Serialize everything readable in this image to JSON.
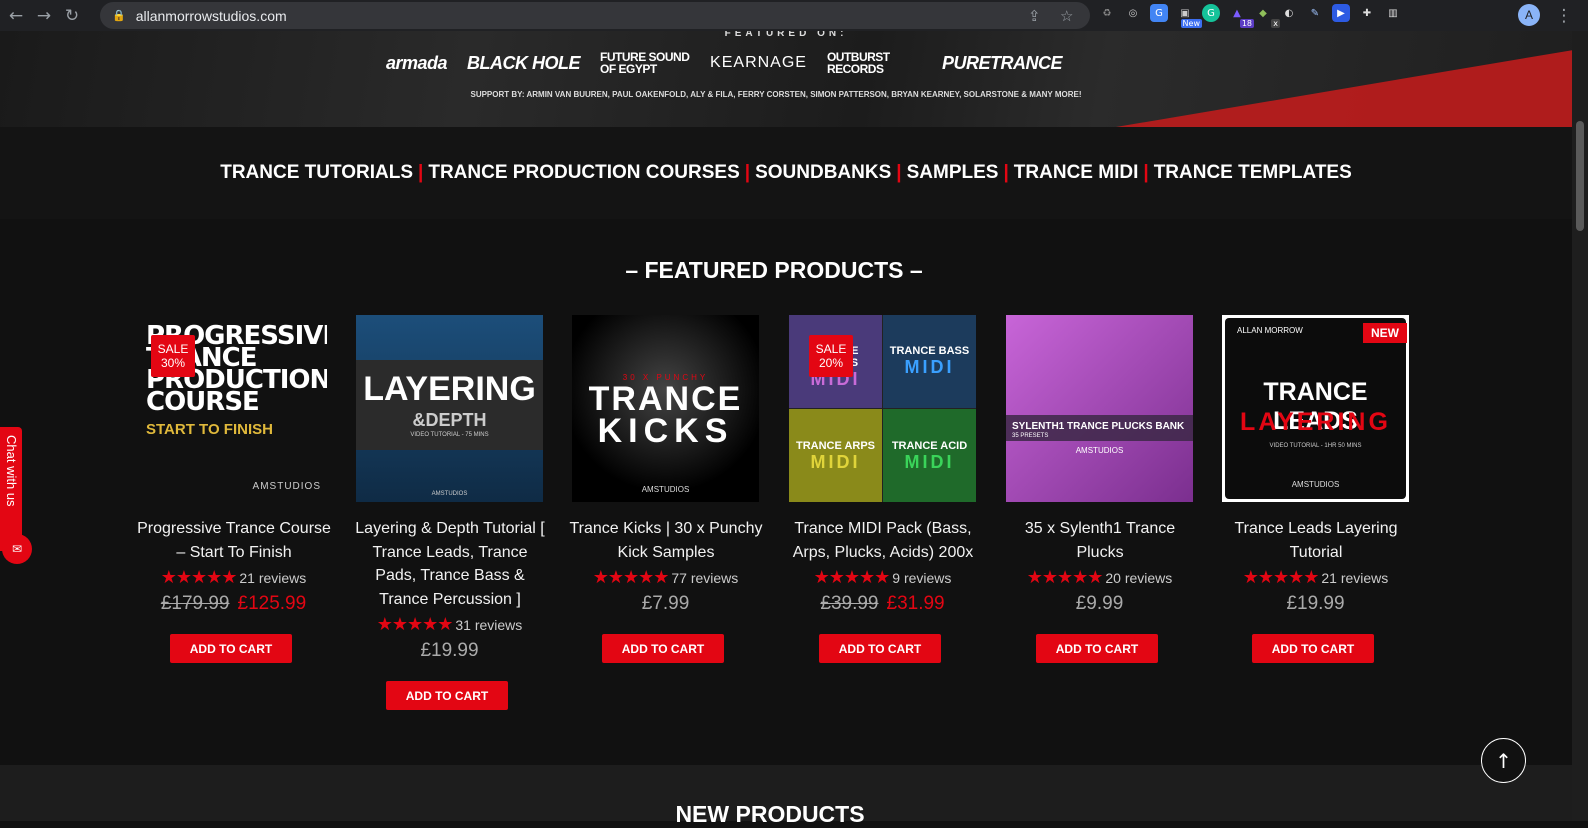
{
  "browser": {
    "url": "allanmorrowstudios.com",
    "profile_initial": "A",
    "ext_badges": {
      "new": "New",
      "count": "18",
      "x": "x"
    }
  },
  "hero": {
    "featured_on": "FEATURED ON:",
    "logos": [
      "armada",
      "BLACK HOLE",
      "FUTURE SOUND OF EGYPT",
      "KEARNAGE",
      "OUTBURST RECORDS",
      "PURETRANCE"
    ],
    "support": "SUPPORT BY: ARMIN VAN BUUREN, PAUL OAKENFOLD, ALY & FILA, FERRY CORSTEN, SIMON PATTERSON, BRYAN KEARNEY, SOLARSTONE & MANY MORE!"
  },
  "nav": {
    "items": [
      "TRANCE TUTORIALS",
      "TRANCE PRODUCTION COURSES",
      "SOUNDBANKS",
      "SAMPLES",
      "TRANCE MIDI",
      "TRANCE TEMPLATES"
    ],
    "separator": "|"
  },
  "featured": {
    "title": "– FEATURED PRODUCTS –",
    "products": [
      {
        "title": "Progressive Trance Course – Start To Finish",
        "stars": "★★★★★",
        "reviews": "21 reviews",
        "old_price": "£179.99",
        "price": "£125.99",
        "badge": "SALE 30%",
        "cta": "ADD TO CART",
        "art": {
          "l1": "PROGRESSIVE",
          "l2": "TRANCE",
          "l3": "PRODUCTION",
          "l4": "COURSE",
          "l5": "START TO FINISH",
          "brand": "AMSTUDIOS"
        }
      },
      {
        "title": "Layering & Depth Tutorial [ Trance Leads, Trance Pads, Trance Bass & Trance Percussion ]",
        "stars": "★★★★★",
        "reviews": "31 reviews",
        "price": "£19.99",
        "cta": "ADD TO CART",
        "art": {
          "l1": "LAYERING",
          "l2": "&DEPTH",
          "l3": "VIDEO TUTORIAL - 75 MINS",
          "brand": "AMSTUDIOS"
        }
      },
      {
        "title": "Trance Kicks | 30 x Punchy Kick Samples",
        "stars": "★★★★★",
        "reviews": "77 reviews",
        "price": "£7.99",
        "cta": "ADD TO CART",
        "art": {
          "sub": "30 X PUNCHY",
          "l1": "TRANCE",
          "l2": "KICKS",
          "brand": "AMSTUDIOS"
        }
      },
      {
        "title": "Trance MIDI Pack (Bass, Arps, Plucks, Acids) 200x",
        "stars": "★★★★★",
        "reviews": "9 reviews",
        "old_price": "£39.99",
        "price": "£31.99",
        "badge": "SALE 20%",
        "cta": "ADD TO CART",
        "art": {
          "q1": "TRANCE PLUCKS",
          "q2": "TRANCE BASS",
          "q3": "TRANCE ARPS",
          "q4": "TRANCE ACID",
          "midi": "MIDI"
        }
      },
      {
        "title": "35 x Sylenth1 Trance Plucks",
        "stars": "★★★★★",
        "reviews": "20 reviews",
        "price": "£9.99",
        "cta": "ADD TO CART",
        "art": {
          "l1": "SYLENTH1 TRANCE PLUCKS BANK",
          "l2": "35 PRESETS",
          "brand": "AMSTUDIOS"
        }
      },
      {
        "title": "Trance Leads Layering Tutorial",
        "stars": "★★★★★",
        "reviews": "21 reviews",
        "price": "£19.99",
        "badge": "NEW",
        "cta": "ADD TO CART",
        "art": {
          "top": "ALLAN MORROW",
          "l1": "TRANCE LEADS",
          "l2": "LAYERING",
          "l3": "VIDEO TUTORIAL - 1HR 50 MINS",
          "brand": "AMSTUDIOS"
        }
      }
    ]
  },
  "chat": {
    "label": "Chat with us"
  },
  "next_section": {
    "title": "NEW PRODUCTS"
  },
  "colors": {
    "accent": "#e30613",
    "background": "#111111",
    "nav_bg": "#141414"
  },
  "icons": [
    "back-icon",
    "forward-icon",
    "reload-icon",
    "lock-icon",
    "share-icon",
    "star-icon",
    "arrow-up-icon",
    "chat-bubble-icon"
  ]
}
